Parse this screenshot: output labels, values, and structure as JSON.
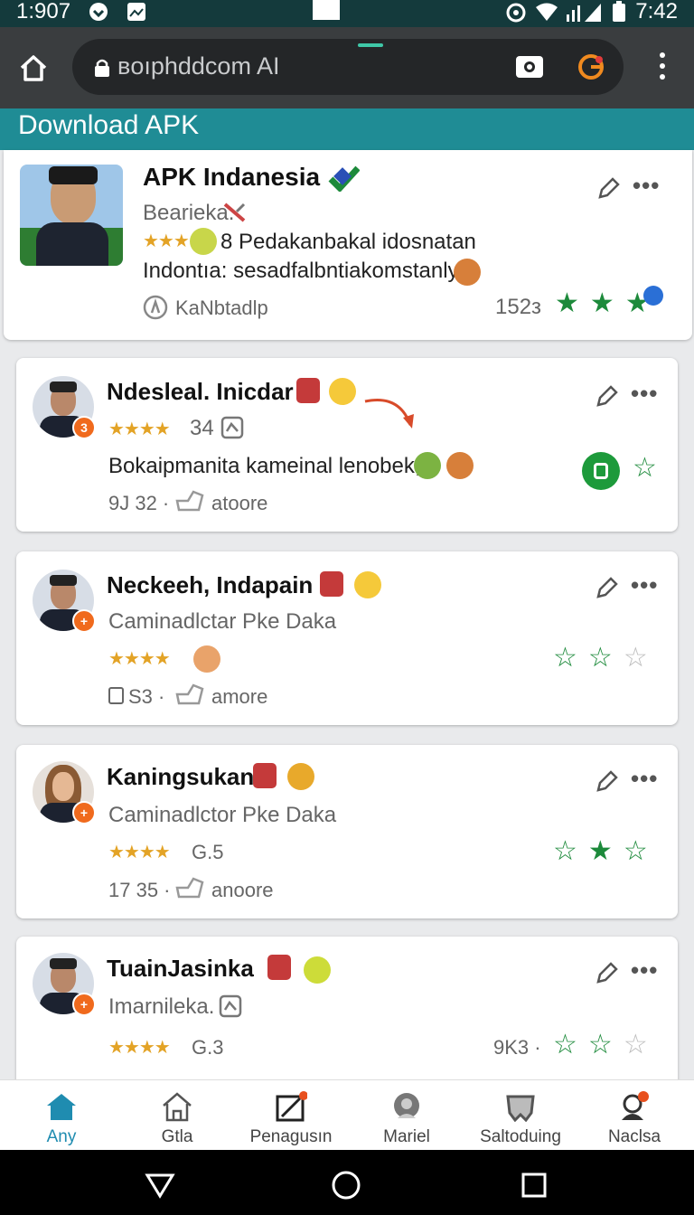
{
  "statusbar": {
    "time_left": "1:907",
    "time_right": "7:42"
  },
  "browser": {
    "url": "ʙoıphddcom AI"
  },
  "banner": {
    "title": "Download APK"
  },
  "featured": {
    "title": "APK Indanesia",
    "subtitle": "Bearieka.",
    "line1": "8 Pedakanbakal idosnatan",
    "line2": "Indontıa: sesadfalbntiakomstanly",
    "developer": "KaNbtadlp",
    "count": "152з",
    "stars": [
      "fill",
      "fill",
      "fill"
    ]
  },
  "cards": [
    {
      "title": "Ndesleal. Inicdar",
      "rating_text": "34",
      "line": "Bokaipmanita kameinal lenobek,",
      "meta_num": "9J 32 ·",
      "meta_label": "atoore",
      "stars": [
        "badge",
        "out"
      ]
    },
    {
      "title": "Neckeeh, Indapain",
      "subtitle": "Caminadlctar Pke Daka",
      "meta_num": "S3 ·",
      "meta_label": "amore",
      "stars": [
        "out",
        "out",
        "grey"
      ]
    },
    {
      "title": "Kaningsukan",
      "subtitle": "Caminadlctor Pke Daka",
      "rating_text": "G.5",
      "meta_num": "17 35 ·",
      "meta_label": "anoore",
      "stars": [
        "out",
        "fill",
        "out"
      ]
    },
    {
      "title": "TuainJasinka",
      "subtitle": "Imarnileka.",
      "rating_text": "G.3",
      "count": "9K3 ·",
      "stars": [
        "out",
        "out",
        "grey"
      ]
    }
  ],
  "bottom_nav": [
    {
      "label": "Any",
      "icon": "home-filled-icon",
      "active": true
    },
    {
      "label": "Gtla",
      "icon": "home-outline-icon"
    },
    {
      "label": "Penagusın",
      "icon": "edit-square-icon"
    },
    {
      "label": "Mariel",
      "icon": "chat-bubble-icon"
    },
    {
      "label": "Saltoduing",
      "icon": "badge-icon"
    },
    {
      "label": "Naclsa",
      "icon": "profile-icon"
    }
  ],
  "colors": {
    "accent": "#1f8c95",
    "star_green": "#1d8a3b",
    "star_gold": "#e3a326",
    "badge_orange": "#f06a1d"
  }
}
